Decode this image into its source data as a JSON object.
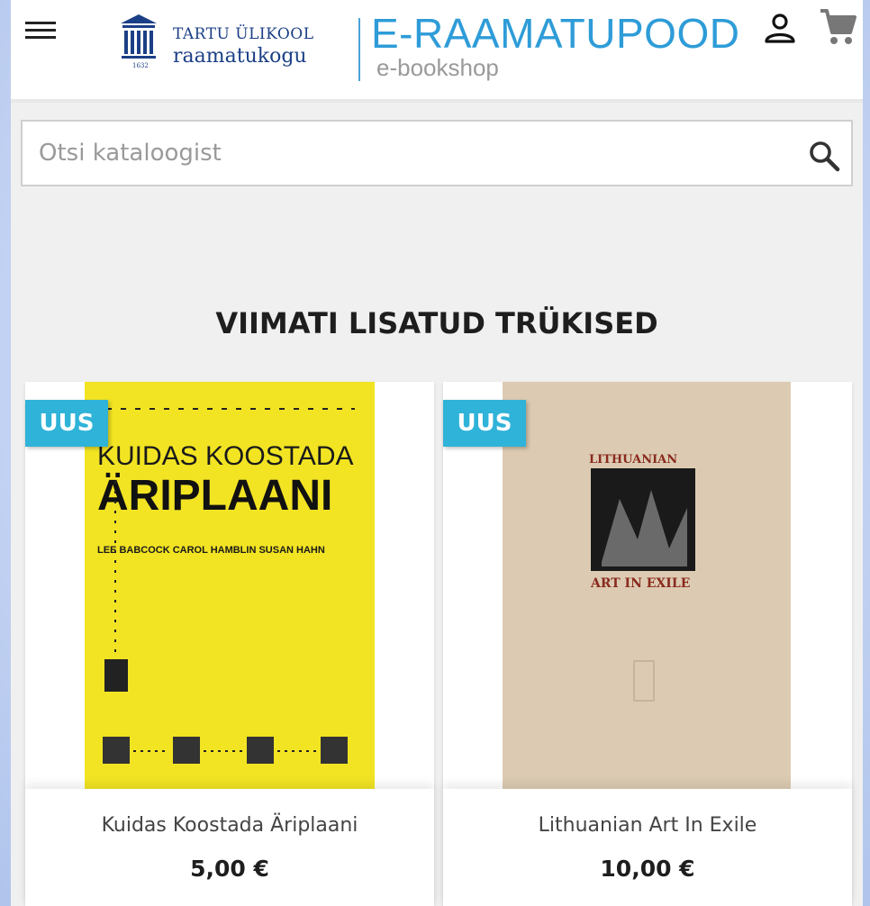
{
  "header": {
    "logo_university": "TARTU ÜLIKOOL",
    "logo_library": "raamatukogu",
    "logo_year": "1632",
    "store_title": "E-RAAMATUPOOD",
    "store_subtitle": "e-bookshop",
    "icons": {
      "menu": "hamburger-menu-icon",
      "user": "user-icon",
      "cart": "cart-icon"
    }
  },
  "search": {
    "placeholder": "Otsi kataloogist",
    "value": "",
    "icon": "search-icon"
  },
  "section": {
    "title": "VIIMATI LISATUD TRÜKISED"
  },
  "products": [
    {
      "badge": "UUS",
      "name": "Kuidas Koostada Äriplaani",
      "price": "5,00 €",
      "cover": {
        "line1": "KUIDAS KOOSTADA",
        "line2": "ÄRIPLAANI",
        "authors": "LEE BABCOCK  CAROL HAMBLIN  SUSAN HAHN"
      }
    },
    {
      "badge": "UUS",
      "name": "Lithuanian Art In Exile",
      "price": "10,00 €",
      "cover": {
        "line1": "LITHUANIAN",
        "line2": "ART IN EXILE"
      }
    }
  ],
  "colors": {
    "accent": "#2fb3d8",
    "brand_blue": "#1b3f86",
    "title_blue": "#2e9cd8"
  }
}
